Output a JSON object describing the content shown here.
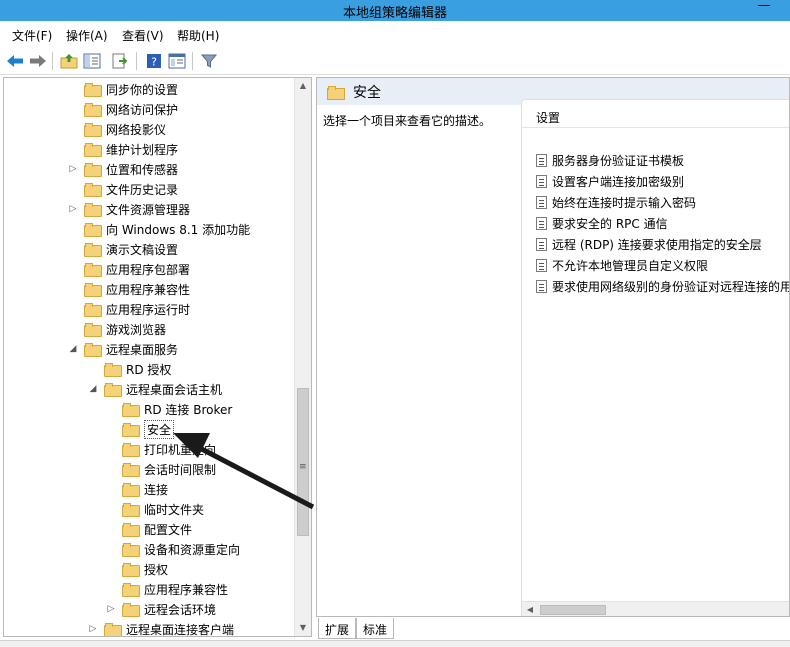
{
  "window": {
    "title": "本地组策略编辑器",
    "minimize_glyph": "—"
  },
  "menu": [
    "文件(F)",
    "操作(A)",
    "查看(V)",
    "帮助(H)"
  ],
  "toolbar": {
    "icons": [
      "back-icon",
      "forward-icon",
      "up-folder-icon",
      "show-hide-tree-icon",
      "export-list-icon",
      "help-icon",
      "properties-icon",
      "filter-icon"
    ]
  },
  "tree": {
    "items": [
      {
        "label": "同步你的设置",
        "level": 0,
        "expander": ""
      },
      {
        "label": "网络访问保护",
        "level": 0,
        "expander": ""
      },
      {
        "label": "网络投影仪",
        "level": 0,
        "expander": ""
      },
      {
        "label": "维护计划程序",
        "level": 0,
        "expander": ""
      },
      {
        "label": "位置和传感器",
        "level": 0,
        "expander": "▷"
      },
      {
        "label": "文件历史记录",
        "level": 0,
        "expander": ""
      },
      {
        "label": "文件资源管理器",
        "level": 0,
        "expander": "▷"
      },
      {
        "label": "向 Windows 8.1 添加功能",
        "level": 0,
        "expander": ""
      },
      {
        "label": "演示文稿设置",
        "level": 0,
        "expander": ""
      },
      {
        "label": "应用程序包部署",
        "level": 0,
        "expander": ""
      },
      {
        "label": "应用程序兼容性",
        "level": 0,
        "expander": ""
      },
      {
        "label": "应用程序运行时",
        "level": 0,
        "expander": ""
      },
      {
        "label": "游戏浏览器",
        "level": 0,
        "expander": ""
      },
      {
        "label": "远程桌面服务",
        "level": 0,
        "expander": "◢"
      },
      {
        "label": "RD 授权",
        "level": 1,
        "expander": ""
      },
      {
        "label": "远程桌面会话主机",
        "level": 1,
        "expander": "◢"
      },
      {
        "label": "RD 连接 Broker",
        "level": 2,
        "expander": ""
      },
      {
        "label": "安全",
        "level": 2,
        "expander": "",
        "selected": true
      },
      {
        "label": "打印机重定向",
        "level": 2,
        "expander": ""
      },
      {
        "label": "会话时间限制",
        "level": 2,
        "expander": ""
      },
      {
        "label": "连接",
        "level": 2,
        "expander": ""
      },
      {
        "label": "临时文件夹",
        "level": 2,
        "expander": ""
      },
      {
        "label": "配置文件",
        "level": 2,
        "expander": ""
      },
      {
        "label": "设备和资源重定向",
        "level": 2,
        "expander": ""
      },
      {
        "label": "授权",
        "level": 2,
        "expander": ""
      },
      {
        "label": "应用程序兼容性",
        "level": 2,
        "expander": ""
      },
      {
        "label": "远程会话环境",
        "level": 2,
        "expander": "▷"
      },
      {
        "label": "远程桌面连接客户端",
        "level": 1,
        "expander": "▷"
      }
    ]
  },
  "right": {
    "header": "安全",
    "description": "选择一个项目来查看它的描述。",
    "column": "设置",
    "settings": [
      "服务器身份验证证书模板",
      "设置客户端连接加密级别",
      "始终在连接时提示输入密码",
      "要求安全的 RPC 通信",
      "远程 (RDP) 连接要求使用指定的安全层",
      "不允许本地管理员自定义权限",
      "要求使用网络级别的身份验证对远程连接的用"
    ]
  },
  "tabs": [
    "扩展",
    "标准"
  ]
}
